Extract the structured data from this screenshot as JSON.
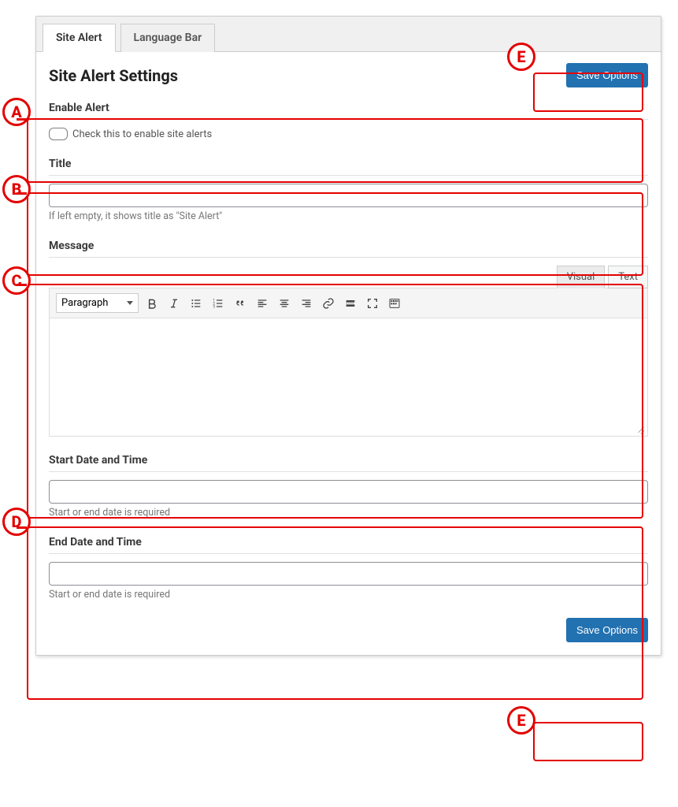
{
  "tabs": {
    "site_alert": "Site Alert",
    "language_bar": "Language Bar"
  },
  "page_title": "Site Alert Settings",
  "buttons": {
    "save_options": "Save Options"
  },
  "fields": {
    "enable": {
      "label": "Enable Alert",
      "checkbox_label": "Check this to enable site alerts"
    },
    "title": {
      "label": "Title",
      "value": "",
      "helper": "If left empty, it shows title as \"Site Alert\""
    },
    "message": {
      "label": "Message",
      "editor_tabs": {
        "visual": "Visual",
        "text": "Text"
      },
      "format_selected": "Paragraph"
    },
    "start": {
      "label": "Start Date and Time",
      "value": "",
      "helper": "Start or end date is required"
    },
    "end": {
      "label": "End Date and Time",
      "value": "",
      "helper": "Start or end date is required"
    }
  },
  "annotations": {
    "A": "A",
    "B": "B",
    "C": "C",
    "D": "D",
    "E": "E"
  }
}
